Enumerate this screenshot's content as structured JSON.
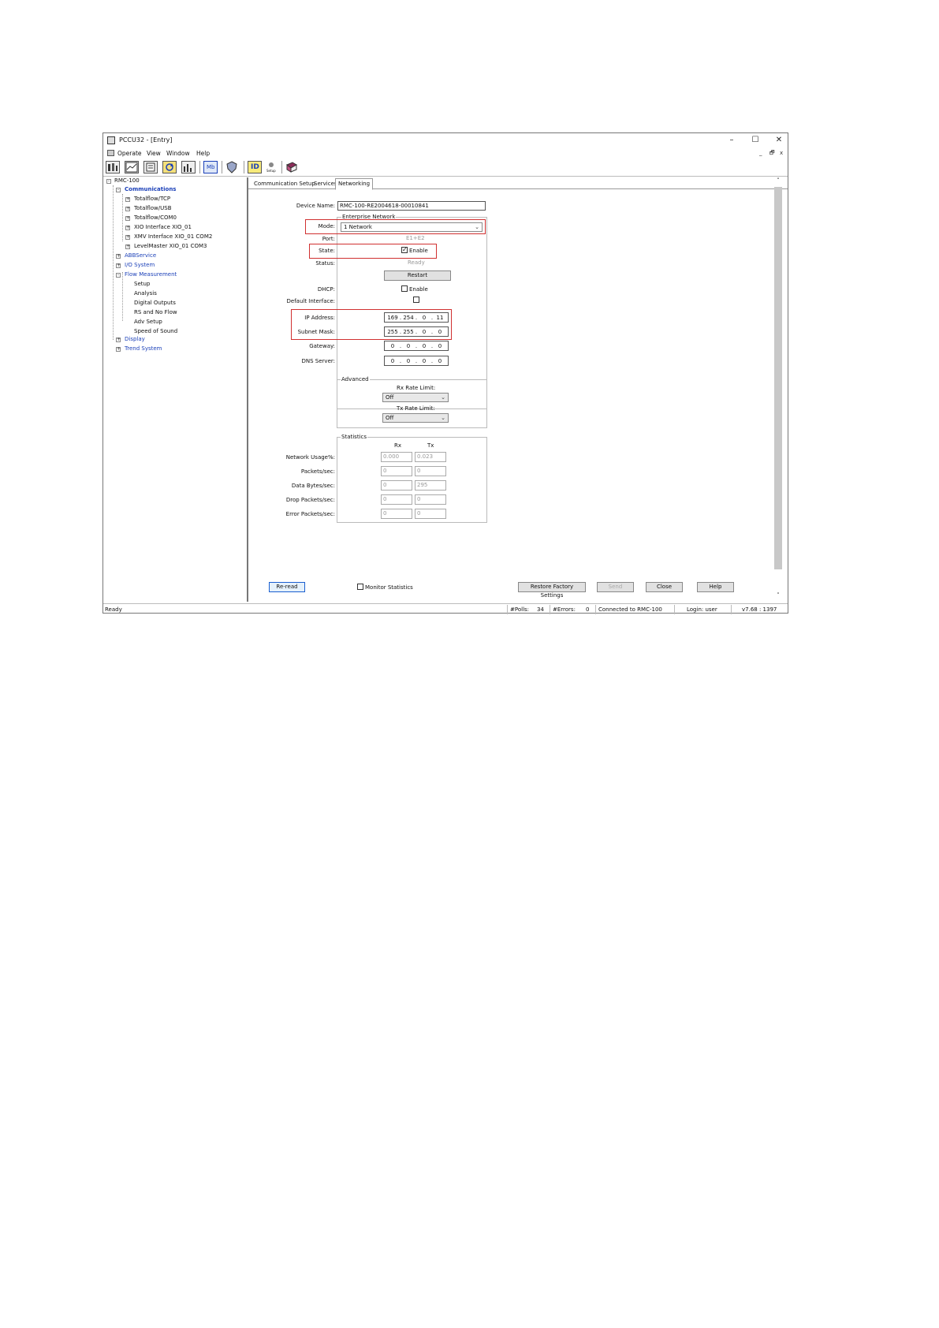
{
  "window": {
    "title": "PCCU32 - [Entry]",
    "minimize": "–",
    "maximize": "☐",
    "close": "✕"
  },
  "menu": {
    "items": [
      "Operate",
      "View",
      "Window",
      "Help"
    ],
    "mdi_controls": [
      "_",
      "🗗",
      "x"
    ]
  },
  "toolbar": {
    "icons": [
      "meter-icon",
      "chart-icon",
      "document-icon",
      "refresh-icon",
      "trend-icon",
      "mb-icon",
      "shield-icon",
      "id-icon",
      "setup-icon",
      "book-icon"
    ],
    "mb_label": "Mb",
    "id_label": "ID",
    "setup_label": "Setup"
  },
  "tree": {
    "root": "RMC-100",
    "communications": "Communications",
    "comm_children": [
      "Totalflow/TCP",
      "Totalflow/USB",
      "Totalflow/COM0",
      "XIO Interface XIO_01",
      "XMV Interface XIO_01 COM2",
      "LevelMaster XIO_01 COM3"
    ],
    "abbservice": "ABBService",
    "io_system": "I/O System",
    "flow_measurement": "Flow Measurement",
    "flow_children": [
      "Setup",
      "Analysis",
      "Digital Outputs",
      "RS and No Flow",
      "Adv Setup",
      "Speed of Sound"
    ],
    "display": "Display",
    "trend_system": "Trend System"
  },
  "tabs": [
    "Communication Setup",
    "Services",
    "Networking"
  ],
  "form": {
    "device_name_label": "Device Name:",
    "device_name_value": "RMC-100-RE2004618-00010841",
    "enterprise_network": "Enterprise Network",
    "mode_label": "Mode:",
    "mode_value": "1 Network",
    "port_label": "Port:",
    "port_value": "E1+E2",
    "state_label": "State:",
    "state_enable": "Enable",
    "status_label": "Status:",
    "status_value": "Ready",
    "restart_button": "Restart",
    "dhcp_label": "DHCP:",
    "dhcp_enable": "Enable",
    "default_interface_label": "Default Interface:",
    "ip_address_label": "IP Address:",
    "ip_address": [
      "169",
      "254",
      "0",
      "11"
    ],
    "subnet_mask_label": "Subnet Mask:",
    "subnet_mask": [
      "255",
      "255",
      "0",
      "0"
    ],
    "gateway_label": "Gateway:",
    "gateway": [
      "0",
      "0",
      "0",
      "0"
    ],
    "dns_label": "DNS Server:",
    "dns": [
      "0",
      "0",
      "0",
      "0"
    ]
  },
  "advanced": {
    "title": "Advanced",
    "rx_rate_label": "Rx Rate Limit:",
    "rx_rate_value": "Off",
    "tx_rate_label": "Tx Rate Limit:",
    "tx_rate_value": "Off"
  },
  "statistics": {
    "title": "Statistics",
    "col_rx": "Rx",
    "col_tx": "Tx",
    "rows": [
      {
        "label": "Network Usage%:",
        "rx": "0.000",
        "tx": "0.023"
      },
      {
        "label": "Packets/sec:",
        "rx": "0",
        "tx": "0"
      },
      {
        "label": "Data Bytes/sec:",
        "rx": "0",
        "tx": "295"
      },
      {
        "label": "Drop Packets/sec:",
        "rx": "0",
        "tx": "0"
      },
      {
        "label": "Error Packets/sec:",
        "rx": "0",
        "tx": "0"
      }
    ]
  },
  "bottom": {
    "reread_button": "Re-read",
    "monitor_statistics": "Monitor Statistics",
    "restore_button": "Restore Factory Settings",
    "send_button": "Send",
    "close_button": "Close",
    "help_button": "Help"
  },
  "statusbar": {
    "ready": "Ready",
    "polls_label": "#Polls:",
    "polls_value": "34",
    "errors_label": "#Errors:",
    "errors_value": "0",
    "connected": "Connected to RMC-100",
    "login": "Login: user",
    "version": "v7.68 : 1397"
  }
}
